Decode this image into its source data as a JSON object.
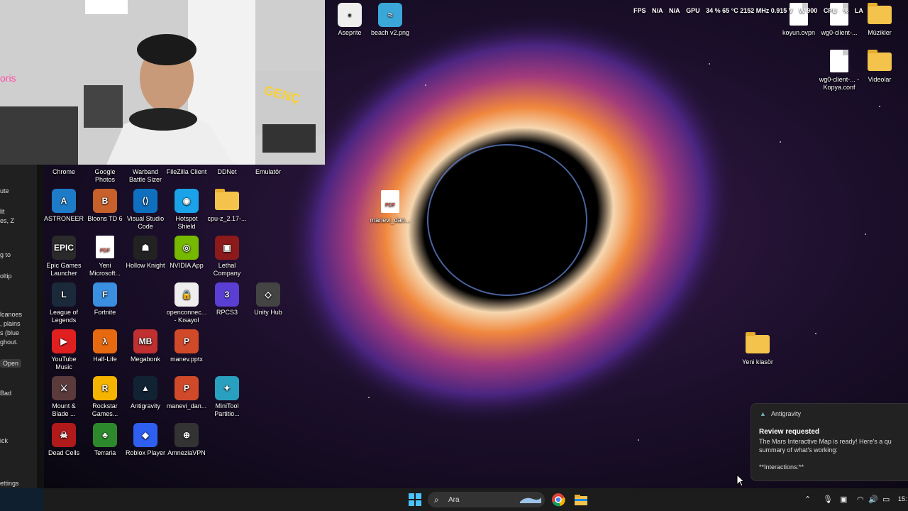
{
  "overlay": {
    "fps_label": "FPS",
    "fps_value": "N/A",
    "fps_value2": "N/A",
    "gpu_label": "GPU",
    "gpu_stats": "34 % 65 °C 2152 MHz 0.915 V",
    "w900": "W 900",
    "cpu_label": "CPU",
    "cpu_val": "%",
    "la": "LA"
  },
  "sidepanel": [
    "ute",
    "lit",
    "es, Z",
    "g to",
    "oltip",
    "lcanoes",
    ", plains",
    "s (blue",
    "ghout.",
    "Open",
    "Bad",
    "ick",
    "ettings"
  ],
  "desktop_icons": [
    {
      "label": "Chrome",
      "color": "#1a73e8",
      "glyph": "",
      "type": "app"
    },
    {
      "label": "Google Photos",
      "color": "#ea4335",
      "glyph": "",
      "type": "app"
    },
    {
      "label": "Warband Battle Sizer",
      "color": "#554",
      "glyph": "",
      "type": "app"
    },
    {
      "label": "FileZilla Client",
      "color": "#b22",
      "glyph": "",
      "type": "app"
    },
    {
      "label": "DDNet",
      "color": "#69c",
      "glyph": "",
      "type": "app"
    },
    {
      "label": "Emulatör",
      "color": "#777",
      "glyph": "",
      "type": "app"
    },
    {
      "label": "ASTRONEER",
      "color": "#1d7bc8",
      "glyph": "A",
      "type": "app"
    },
    {
      "label": "Bloons TD 6",
      "color": "#c7602a",
      "glyph": "B",
      "type": "app"
    },
    {
      "label": "Visual Studio Code",
      "color": "#0f6fbf",
      "glyph": "⟨⟩",
      "type": "app"
    },
    {
      "label": "Hotspot Shield",
      "color": "#1aa3e8",
      "glyph": "◉",
      "type": "app"
    },
    {
      "label": "cpu-z_2.17-...",
      "color": "",
      "glyph": "",
      "type": "folder"
    },
    {
      "label": "Epic Games Launcher",
      "color": "#2a2a2a",
      "glyph": "EPIC",
      "type": "app"
    },
    {
      "label": "Yeni Microsoft...",
      "color": "",
      "glyph": "PDF",
      "type": "pdf"
    },
    {
      "label": "Hollow Knight",
      "color": "#222",
      "glyph": "☗",
      "type": "app"
    },
    {
      "label": "NVIDIA App",
      "color": "#76b900",
      "glyph": "◎",
      "type": "app"
    },
    {
      "label": "Lethal Company",
      "color": "#8c1a1a",
      "glyph": "▣",
      "type": "app"
    },
    {
      "label": "League of Legends",
      "color": "#1b2a3a",
      "glyph": "L",
      "type": "app"
    },
    {
      "label": "Fortnite",
      "color": "#3a8fe0",
      "glyph": "F",
      "type": "app"
    },
    {
      "label": "openconnec... - Kısayol",
      "color": "#eee",
      "glyph": "🔒",
      "type": "app"
    },
    {
      "label": "RPCS3",
      "color": "#5b3fd4",
      "glyph": "3",
      "type": "app"
    },
    {
      "label": "Unity Hub",
      "color": "#444",
      "glyph": "◇",
      "type": "app"
    },
    {
      "label": "YouTube Music",
      "color": "#e02020",
      "glyph": "▶",
      "type": "app"
    },
    {
      "label": "Half-Life",
      "color": "#e86a10",
      "glyph": "λ",
      "type": "app"
    },
    {
      "label": "Megabonk",
      "color": "#c03030",
      "glyph": "MB",
      "type": "app"
    },
    {
      "label": "manev.pptx",
      "color": "#d04a2a",
      "glyph": "P",
      "type": "app"
    },
    {
      "label": "Mount & Blade ...",
      "color": "#5a3a3a",
      "glyph": "⚔",
      "type": "app"
    },
    {
      "label": "Rockstar Games...",
      "color": "#f4b400",
      "glyph": "R",
      "type": "app"
    },
    {
      "label": "Antigravity",
      "color": "#123",
      "glyph": "▲",
      "type": "app"
    },
    {
      "label": "manevi_dan...",
      "color": "#d04a2a",
      "glyph": "P",
      "type": "app"
    },
    {
      "label": "MiniTool Partitio...",
      "color": "#2aa0c0",
      "glyph": "✦",
      "type": "app"
    },
    {
      "label": "Dead Cells",
      "color": "#b01a1a",
      "glyph": "☠",
      "type": "app"
    },
    {
      "label": "Terraria",
      "color": "#2c8a2c",
      "glyph": "♣",
      "type": "app"
    },
    {
      "label": "Roblox Player",
      "color": "#2f5ff0",
      "glyph": "◆",
      "type": "app"
    },
    {
      "label": "AmneziaVPN",
      "color": "#333",
      "glyph": "⊕",
      "type": "app"
    }
  ],
  "right_icons": [
    {
      "label": "Aseprite",
      "type": "app",
      "color": "#eee",
      "glyph": "▪"
    },
    {
      "label": "beach v2.png",
      "type": "app",
      "color": "#3aa7d8",
      "glyph": "≈"
    },
    {
      "label": "koyun.ovpn",
      "type": "doc"
    },
    {
      "label": "wg0-client-...",
      "type": "doc"
    },
    {
      "label": "Müzikler",
      "type": "folder"
    },
    {
      "label": "wg0-client-... - Kopya.conf",
      "type": "doc"
    },
    {
      "label": "Videolar",
      "type": "folder"
    },
    {
      "label": "manevi_dan...",
      "type": "pdf"
    },
    {
      "label": "Yeni klasör",
      "type": "folder"
    }
  ],
  "notification": {
    "app": "Antigravity",
    "title": "Review requested",
    "body": "The Mars Interactive Map is ready! Here's a qu summary of what's working:\n\n**Interactions:**"
  },
  "taskbar": {
    "search_placeholder": "Ara",
    "clock": "15:"
  }
}
